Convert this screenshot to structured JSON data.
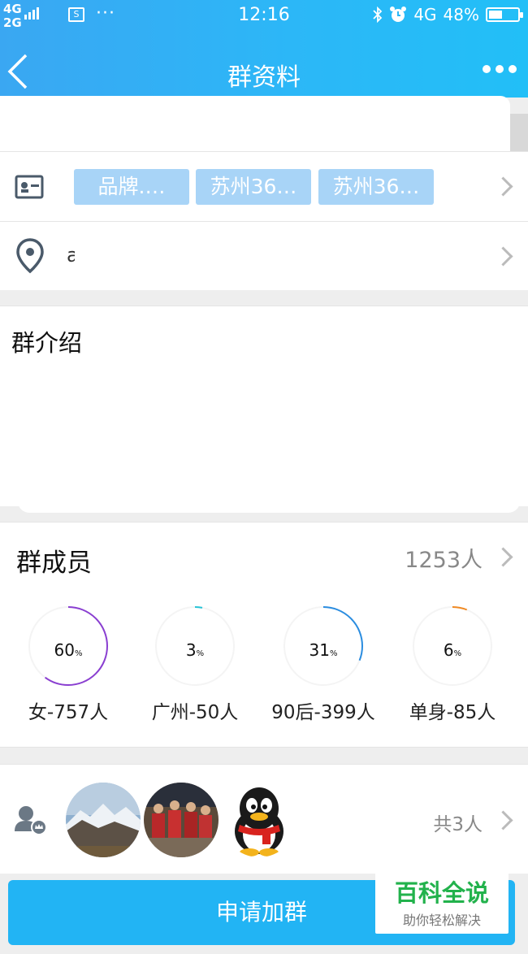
{
  "status_bar": {
    "network_top": "4G",
    "network_bottom": "2G",
    "time": "12:16",
    "signal_right": "4G",
    "battery": "48%"
  },
  "header": {
    "title": "群资料"
  },
  "tags": [
    "品牌.…",
    "苏州36…",
    "苏州36…"
  ],
  "location": {
    "text": "a"
  },
  "intro": {
    "heading": "群介绍"
  },
  "members": {
    "heading": "群成员",
    "count": "1253人",
    "stats": [
      {
        "percent": 60,
        "label": "女-757人",
        "color": "#8a3fd1"
      },
      {
        "percent": 3,
        "label": "广州-50人",
        "color": "#27c3d6"
      },
      {
        "percent": 31,
        "label": "90后-399人",
        "color": "#2b8de0"
      },
      {
        "percent": 6,
        "label": "单身-85人",
        "color": "#f08a24"
      }
    ],
    "percent_unit": "%"
  },
  "admins": {
    "count": "共3人"
  },
  "join_button": {
    "label": "申请加群"
  },
  "watermark": {
    "title": "百科全说",
    "subtitle": "助你轻松解决"
  }
}
